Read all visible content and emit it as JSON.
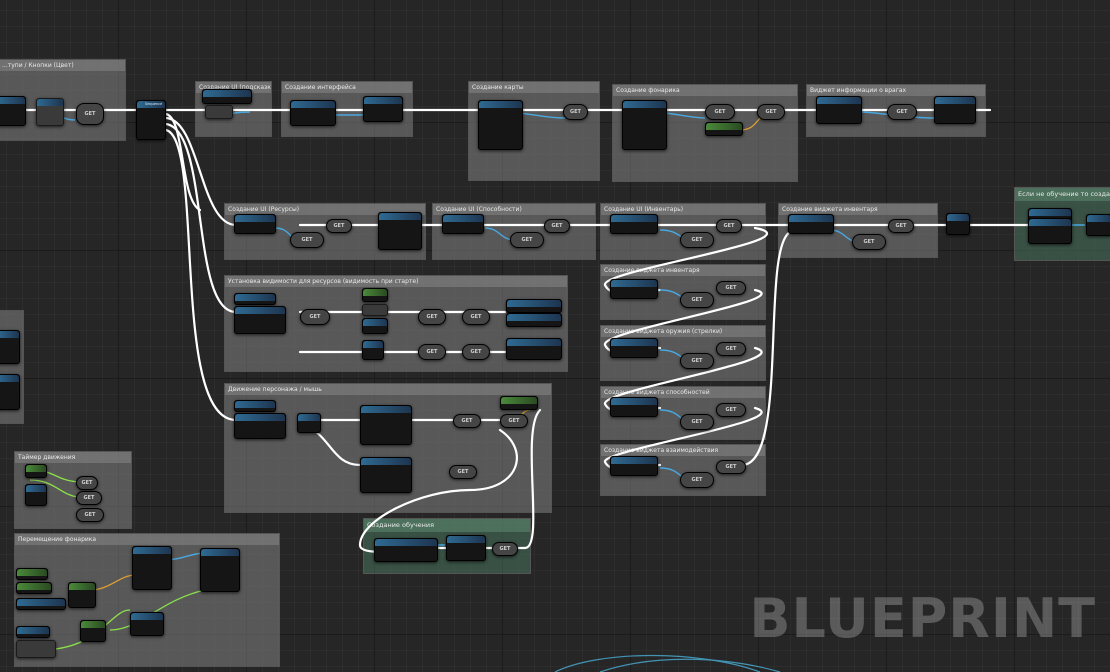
{
  "watermark": "BLUEPRINT",
  "comments": [
    {
      "id": "c-left-top",
      "label": "...тупи / Кнопки (Цвет)"
    },
    {
      "id": "c-ui-1",
      "label": "Создание UI (подсказки)"
    },
    {
      "id": "c-ui-2",
      "label": "Создание интерфейса"
    },
    {
      "id": "c-map",
      "label": "Создание карты"
    },
    {
      "id": "c-flashlight",
      "label": "Создание фонарика"
    },
    {
      "id": "c-ui-info",
      "label": "Виджет информации о врагах"
    },
    {
      "id": "c-save-1",
      "label": "Создание UI (Ресурсы)"
    },
    {
      "id": "c-save-2",
      "label": "Создание UI (Способности)"
    },
    {
      "id": "c-save-3",
      "label": "Создание UI (Инвентарь)"
    },
    {
      "id": "c-save-4",
      "label": "Создание виджета инвентаря"
    },
    {
      "id": "c-tutorial-weapon",
      "label": "Если не обучение то создаем старт оружие"
    },
    {
      "id": "c-save-5",
      "label": "Создание виджета инвентаря"
    },
    {
      "id": "c-save-6",
      "label": "Создание виджета оружия (стрелки)"
    },
    {
      "id": "c-save-7",
      "label": "Создание виджета способностей"
    },
    {
      "id": "c-save-8",
      "label": "Создание виджета взаимодействия"
    },
    {
      "id": "c-mid-1",
      "label": "Установка видимости для ресурсов (видимость при старте)"
    },
    {
      "id": "c-mid-2",
      "label": "Движение персонажа / мышь"
    },
    {
      "id": "c-timer",
      "label": "Таймер движения"
    },
    {
      "id": "c-move",
      "label": "Перемещение фонарика"
    },
    {
      "id": "c-tutorial",
      "label": "Создание обучения"
    }
  ],
  "node_get_label": "GET",
  "sequence_title": "Sequence"
}
